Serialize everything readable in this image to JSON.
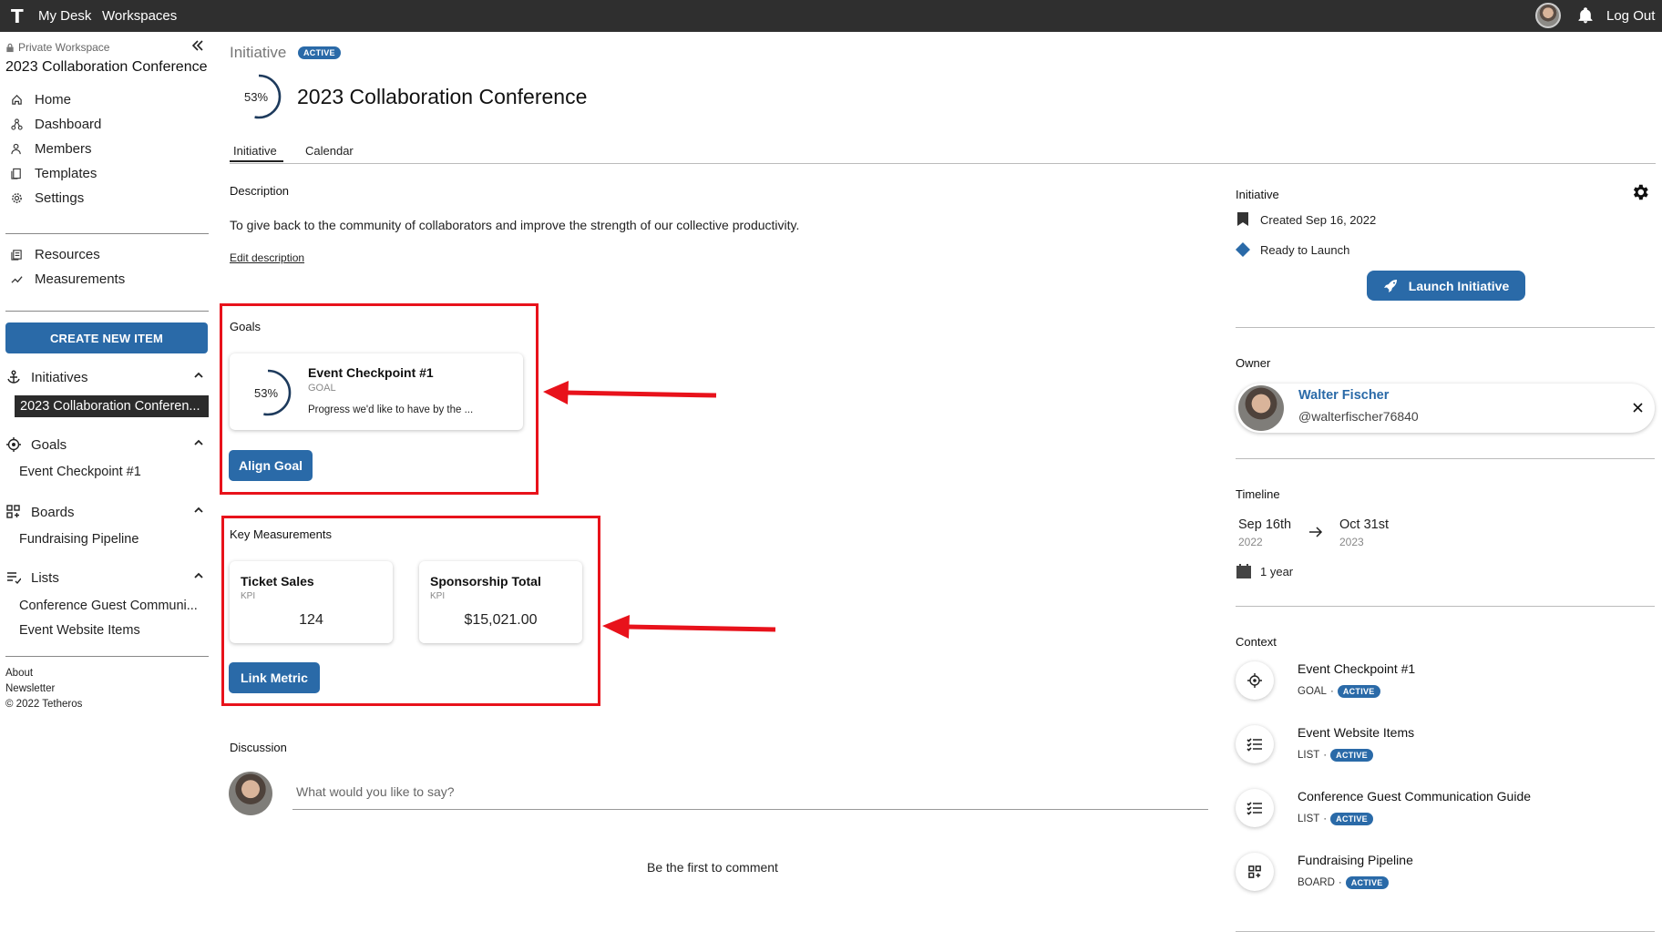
{
  "topbar": {
    "logo": "T",
    "nav": [
      "My Desk",
      "Workspaces"
    ],
    "logout": "Log Out"
  },
  "sidebar": {
    "workspace_label": "Private Workspace",
    "workspace_title": "2023 Collaboration Conference",
    "nav": [
      {
        "label": "Home",
        "icon": "home-icon"
      },
      {
        "label": "Dashboard",
        "icon": "dashboard-icon"
      },
      {
        "label": "Members",
        "icon": "members-icon"
      },
      {
        "label": "Templates",
        "icon": "templates-icon"
      },
      {
        "label": "Settings",
        "icon": "settings-icon"
      }
    ],
    "nav2": [
      {
        "label": "Resources",
        "icon": "resources-icon"
      },
      {
        "label": "Measurements",
        "icon": "measurements-icon"
      }
    ],
    "create_button": "CREATE NEW ITEM",
    "sections": {
      "initiatives": {
        "label": "Initiatives",
        "items": [
          "2023 Collaboration Conferen..."
        ]
      },
      "goals": {
        "label": "Goals",
        "items": [
          "Event Checkpoint #1"
        ]
      },
      "boards": {
        "label": "Boards",
        "items": [
          "Fundraising Pipeline"
        ]
      },
      "lists": {
        "label": "Lists",
        "items": [
          "Conference Guest Communi...",
          "Event Website Items"
        ]
      }
    },
    "footer": [
      "About",
      "Newsletter",
      "© 2022 Tetheros"
    ]
  },
  "main": {
    "breadcrumb": "Initiative",
    "status_badge": "ACTIVE",
    "progress_text": "53%",
    "progress_value": 0.53,
    "title": "2023 Collaboration Conference",
    "tabs": [
      "Initiative",
      "Calendar"
    ],
    "description_heading": "Description",
    "description": "To give back to the community of collaborators and improve the strength of our collective productivity.",
    "edit_description": "Edit description",
    "goals_heading": "Goals",
    "goal_card": {
      "progress_text": "53%",
      "progress_value": 0.53,
      "title": "Event Checkpoint #1",
      "type": "GOAL",
      "snippet": "Progress we'd like to have by the ..."
    },
    "align_goal": "Align Goal",
    "measurements_heading": "Key Measurements",
    "kpis": [
      {
        "title": "Ticket Sales",
        "type": "KPI",
        "value": "124"
      },
      {
        "title": "Sponsorship Total",
        "type": "KPI",
        "value": "$15,021.00"
      }
    ],
    "link_metric": "Link Metric",
    "discussion_heading": "Discussion",
    "comment_placeholder": "What would you like to say?",
    "empty_comments": "Be the first to comment"
  },
  "right_panel": {
    "initiative_heading": "Initiative",
    "created": "Created Sep 16, 2022",
    "status": "Ready to Launch",
    "launch_button": "Launch Initiative",
    "owner_heading": "Owner",
    "owner_name": "Walter Fischer",
    "owner_handle": "@walterfischer76840",
    "timeline_heading": "Timeline",
    "start_date": "Sep 16th",
    "start_year": "2022",
    "end_date": "Oct 31st",
    "end_year": "2023",
    "duration": "1 year",
    "context_heading": "Context",
    "context": [
      {
        "title": "Event Checkpoint #1",
        "type": "GOAL",
        "status": "ACTIVE",
        "icon": "goal-target-icon"
      },
      {
        "title": "Event Website Items",
        "type": "LIST",
        "status": "ACTIVE",
        "icon": "list-icon"
      },
      {
        "title": "Conference Guest Communication Guide",
        "type": "LIST",
        "status": "ACTIVE",
        "icon": "list-icon"
      },
      {
        "title": "Fundraising Pipeline",
        "type": "BOARD",
        "status": "ACTIVE",
        "icon": "board-icon"
      }
    ]
  },
  "colors": {
    "accent": "#2a6aa8",
    "topbar": "#2f2f2f",
    "annotation_red": "#e8121b"
  }
}
